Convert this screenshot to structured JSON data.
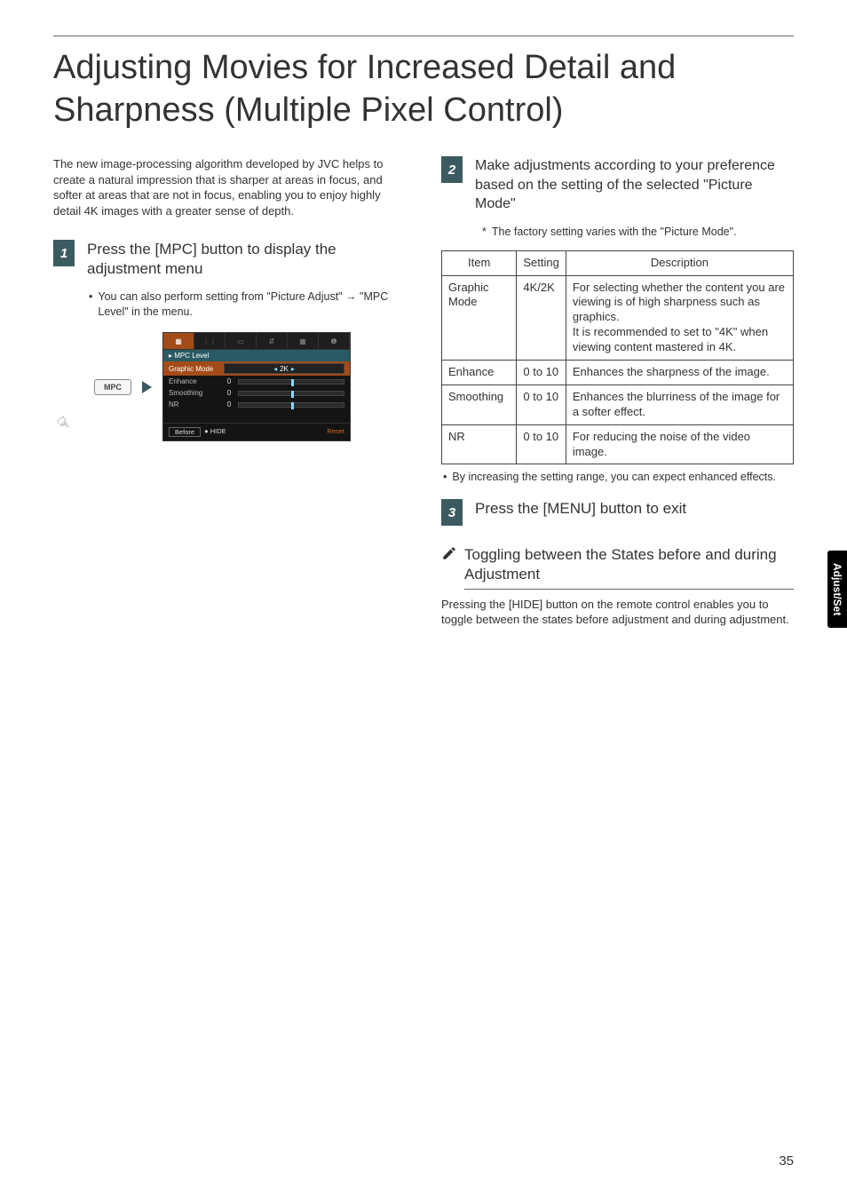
{
  "page_title": "Adjusting Movies for Increased Detail and Sharpness (Multiple Pixel Control)",
  "intro": "The new image-processing algorithm developed by JVC helps to create a natural impression that is sharper at areas in focus, and softer at areas that are not in focus, enabling you to enjoy highly detail 4K images with a greater sense of depth.",
  "step1": {
    "num": "1",
    "text": "Press the [MPC] button to display the adjustment menu",
    "bullet": "You can also perform setting from \"Picture Adjust\" → \"MPC Level\" in the menu."
  },
  "remote_key": "MPC",
  "menu": {
    "head": "MPC Level",
    "rows": {
      "graphic": {
        "label": "Graphic Mode",
        "spin": "2K"
      },
      "enhance": {
        "label": "Enhance",
        "val": "0"
      },
      "smoothing": {
        "label": "Smoothing",
        "val": "0"
      },
      "nr": {
        "label": "NR",
        "val": "0"
      }
    },
    "footer_before": "Before",
    "footer_hide": "● HIDE",
    "footer_reset": "Reset"
  },
  "step2": {
    "num": "2",
    "text": "Make adjustments according to your preference based on the setting of the selected \"Picture Mode\"",
    "footnote": "The factory setting varies with the \"Picture Mode\"."
  },
  "table": {
    "head": {
      "item": "Item",
      "setting": "Setting",
      "desc": "Description"
    },
    "rows": [
      {
        "item": "Graphic Mode",
        "setting": "4K/2K",
        "desc": "For selecting whether the content you are viewing is of high sharpness such as graphics.\nIt is recommended to set to \"4K\" when viewing content mastered in 4K."
      },
      {
        "item": "Enhance",
        "setting": "0 to 10",
        "desc": "Enhances the sharpness of the image."
      },
      {
        "item": "Smoothing",
        "setting": "0 to 10",
        "desc": "Enhances the blurriness of the image for a softer effect."
      },
      {
        "item": "NR",
        "setting": "0 to 10",
        "desc": "For reducing the noise of the video image."
      }
    ]
  },
  "table_note": "By increasing the setting range, you can expect enhanced effects.",
  "step3": {
    "num": "3",
    "text": "Press the [MENU] button to exit"
  },
  "sub": {
    "title": "Toggling between the States before and during Adjustment",
    "body": "Pressing the [HIDE] button on the remote control enables you to toggle between the states before adjustment and during adjustment."
  },
  "side_tab": "Adjust/Set",
  "page_num": "35"
}
